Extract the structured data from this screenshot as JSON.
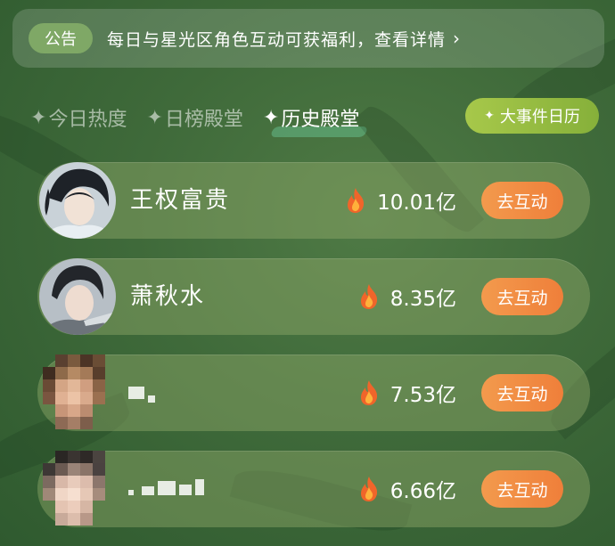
{
  "announcement": {
    "badge": "公告",
    "text": "每日与星光区角色互动可获福利，查看详情",
    "chevron_icon": "chevron-right-icon"
  },
  "tabs": [
    {
      "label": "今日热度",
      "active": false
    },
    {
      "label": "日榜殿堂",
      "active": false
    },
    {
      "label": "历史殿堂",
      "active": true
    }
  ],
  "calendar_button": {
    "label": "大事件日历"
  },
  "ranking": [
    {
      "name": "王权富贵",
      "heat": "10.01亿",
      "action": "去互动"
    },
    {
      "name": "萧秋水",
      "heat": "8.35亿",
      "action": "去互动"
    },
    {
      "name": "",
      "heat": "7.53亿",
      "action": "去互动"
    },
    {
      "name": "",
      "heat": "6.66亿",
      "action": "去互动"
    }
  ],
  "colors": {
    "accent_orange": "#ef7f3a",
    "badge_green": "#7fa866",
    "calendar_green": "#a7c84a"
  }
}
